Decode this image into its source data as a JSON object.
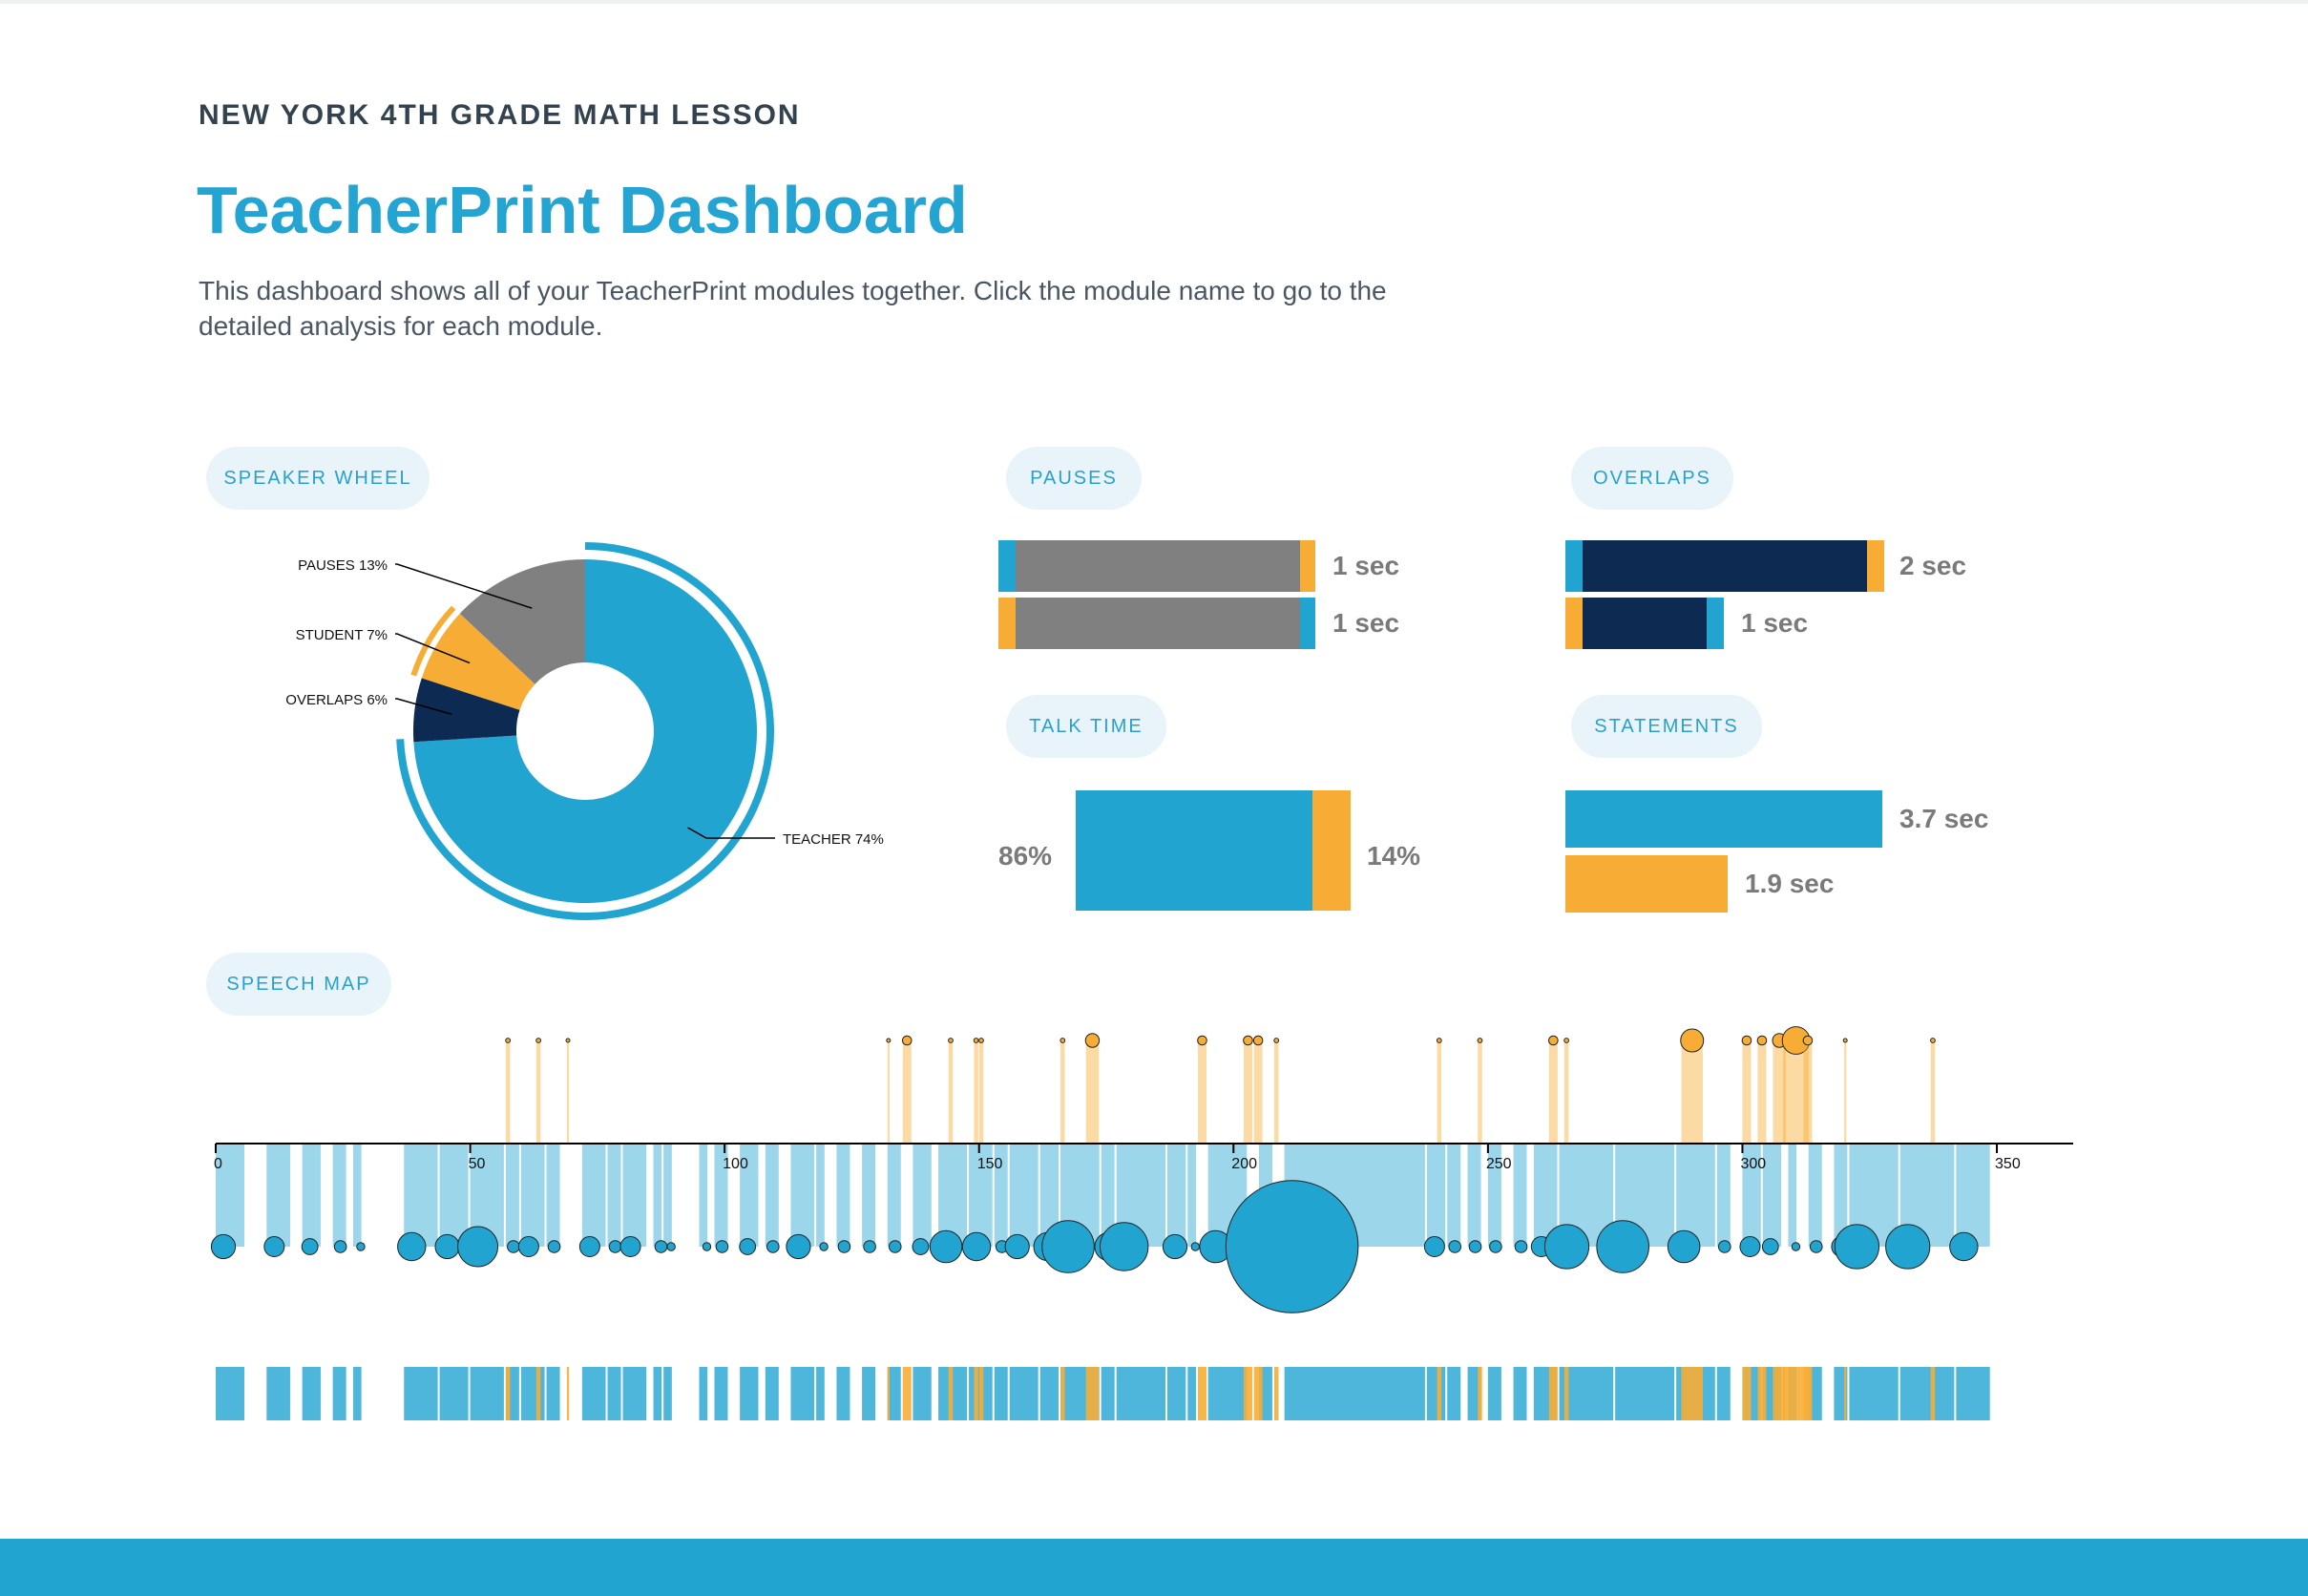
{
  "header": {
    "subtitle": "NEW YORK 4TH GRADE MATH LESSON",
    "title": "TeacherPrint Dashboard",
    "description": "This dashboard shows all of your TeacherPrint modules together. Click the module name to go to the detailed analysis for each module."
  },
  "colors": {
    "teacher": "#22a4d1",
    "student": "#f7ad35",
    "pause": "#808080",
    "overlap": "#0d2a52",
    "footer": "#22a4d1"
  },
  "modules": {
    "speaker_wheel": {
      "label": "SPEAKER WHEEL"
    },
    "pauses": {
      "label": "PAUSES",
      "rows": [
        {
          "value": "1 sec",
          "teacher_frac": 0.055,
          "middle_frac": 0.89,
          "student_frac": 0.055
        },
        {
          "value": "1 sec",
          "student_frac": 0.055,
          "middle_frac": 0.89,
          "teacher_frac": 0.055
        }
      ]
    },
    "overlaps": {
      "label": "OVERLAPS",
      "rows": [
        {
          "value": "2 sec",
          "teacher_frac": 0.055,
          "middle_frac": 0.89,
          "student_frac": 0.055
        },
        {
          "value": "1 sec",
          "student_frac": 0.11,
          "middle_frac": 0.78,
          "teacher_frac": 0.11,
          "length_frac": 0.5
        }
      ]
    },
    "talk_time": {
      "label": "TALK TIME",
      "teacher_pct": "86%",
      "student_pct": "14%",
      "teacher": 86,
      "student": 14
    },
    "statements": {
      "label": "STATEMENTS",
      "teacher_value": "3.7 sec",
      "student_value": "1.9 sec",
      "teacher": 3.7,
      "student": 1.9
    },
    "speech_map": {
      "label": "SPEECH MAP"
    }
  },
  "chart_data": [
    {
      "type": "pie",
      "labels": [
        "TEACHER 74%",
        "OVERLAPS 6%",
        "STUDENT 7%",
        "PAUSES 13%"
      ],
      "values": [
        74,
        6,
        7,
        13
      ]
    },
    {
      "type": "scatter",
      "xlim": [
        0,
        365
      ],
      "x_ticks": [
        "0",
        "50",
        "100",
        "150",
        "200",
        "250",
        "300",
        "350"
      ],
      "teacher_turns": [
        [
          0,
          6
        ],
        [
          10,
          5
        ],
        [
          17,
          4
        ],
        [
          23,
          3
        ],
        [
          27,
          2
        ],
        [
          37,
          7
        ],
        [
          44,
          6
        ],
        [
          50,
          10
        ],
        [
          57,
          3
        ],
        [
          60,
          5
        ],
        [
          65,
          3
        ],
        [
          72,
          5
        ],
        [
          77,
          3
        ],
        [
          80,
          5
        ],
        [
          86,
          3
        ],
        [
          88,
          2
        ],
        [
          95,
          2
        ],
        [
          98,
          3
        ],
        [
          103,
          4
        ],
        [
          108,
          3
        ],
        [
          113,
          6
        ],
        [
          118,
          2
        ],
        [
          122,
          3
        ],
        [
          127,
          3
        ],
        [
          132,
          3
        ],
        [
          137,
          4
        ],
        [
          142,
          8
        ],
        [
          148,
          7
        ],
        [
          153,
          3
        ],
        [
          156,
          6
        ],
        [
          162,
          7
        ],
        [
          166,
          13
        ],
        [
          174,
          7
        ],
        [
          177,
          12
        ],
        [
          187,
          6
        ],
        [
          191,
          2
        ],
        [
          195,
          8
        ],
        [
          205,
          3
        ],
        [
          210,
          33
        ],
        [
          238,
          5
        ],
        [
          242,
          3
        ],
        [
          246,
          3
        ],
        [
          250,
          3
        ],
        [
          255,
          3
        ],
        [
          259,
          5
        ],
        [
          264,
          11
        ],
        [
          275,
          13
        ],
        [
          287,
          8
        ],
        [
          295,
          3
        ],
        [
          300,
          5
        ],
        [
          304,
          4
        ],
        [
          309,
          2
        ],
        [
          313,
          3
        ],
        [
          318,
          5
        ],
        [
          321,
          11
        ],
        [
          331,
          11
        ],
        [
          342,
          7
        ]
      ],
      "student_turns": [
        [
          57,
          1
        ],
        [
          63,
          1
        ],
        [
          69,
          0.5
        ],
        [
          132,
          0.5
        ],
        [
          135,
          2
        ],
        [
          144,
          1
        ],
        [
          149,
          1
        ],
        [
          150,
          1
        ],
        [
          166,
          1
        ],
        [
          171,
          3
        ],
        [
          193,
          2
        ],
        [
          202,
          2
        ],
        [
          204,
          2
        ],
        [
          208,
          1
        ],
        [
          240,
          1
        ],
        [
          248,
          1
        ],
        [
          262,
          2
        ],
        [
          265,
          1
        ],
        [
          288,
          5
        ],
        [
          300,
          2
        ],
        [
          303,
          2
        ],
        [
          306,
          3
        ],
        [
          308,
          6
        ],
        [
          312,
          2
        ],
        [
          320,
          0.5
        ],
        [
          337,
          1
        ]
      ]
    }
  ]
}
